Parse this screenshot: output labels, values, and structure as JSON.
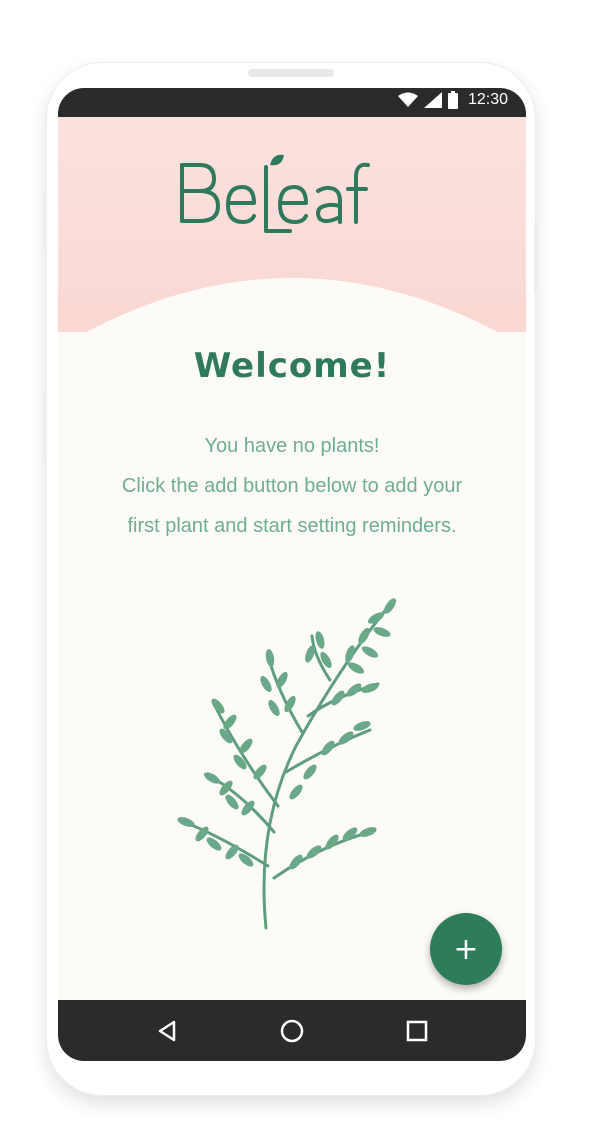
{
  "status_bar": {
    "time": "12:30",
    "icons": [
      "wifi-icon",
      "signal-icon",
      "battery-icon"
    ]
  },
  "header": {
    "logo_text": "BeLeaf"
  },
  "main": {
    "title": "Welcome!",
    "message_lines": [
      "You have no plants!",
      "Click the add button below to add your",
      "first plant and start setting reminders."
    ],
    "illustration": "plant-branch-illustration"
  },
  "fab": {
    "label": "+",
    "icon": "add-icon"
  },
  "nav_bar": {
    "items": [
      "back-icon",
      "home-icon",
      "recents-icon"
    ]
  },
  "colors": {
    "primary": "#2d7d5a",
    "header_bg": "#fbe2df",
    "screen_bg": "#fdfbf5",
    "text_secondary": "#6fae90"
  }
}
